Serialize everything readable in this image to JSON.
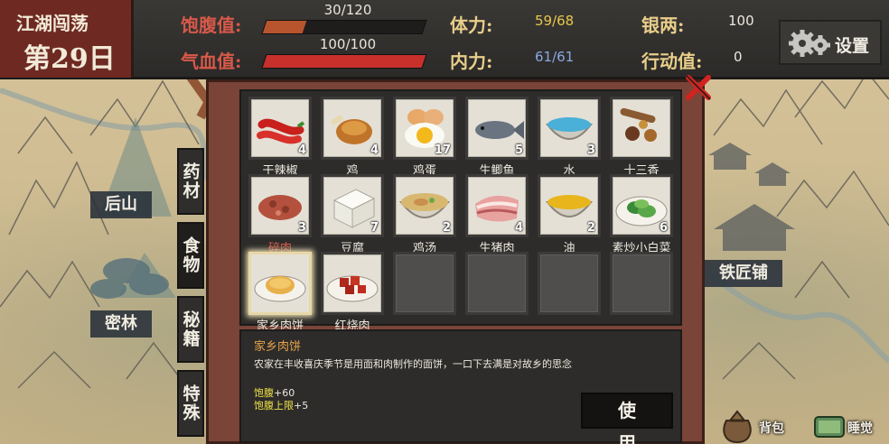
{
  "header": {
    "location": "江湖闯荡",
    "day": "第29日",
    "satiety": {
      "label": "饱腹值:",
      "text": "30/120",
      "fraction": 0.25,
      "color": "#b8542e"
    },
    "health": {
      "label": "气血值:",
      "text": "100/100",
      "fraction": 1.0,
      "color": "#c8302c"
    },
    "stamina": {
      "label": "体力:",
      "value": "59/68"
    },
    "inner_power": {
      "label": "内力:",
      "value": "61/61"
    },
    "silver": {
      "label": "银两:",
      "value": "100"
    },
    "action_points": {
      "label": "行动值:",
      "value": "0"
    },
    "settings_label": "设置"
  },
  "map": {
    "places": [
      "后山",
      "密林",
      "铁匠铺"
    ]
  },
  "inventory": {
    "tabs": [
      "药材",
      "食物",
      "秘籍",
      "特殊"
    ],
    "active_tab": "食物",
    "items": [
      {
        "name": "干辣椒",
        "count": "4",
        "icon": "dried-chili-icon"
      },
      {
        "name": "鸡",
        "count": "4",
        "icon": "roast-chicken-icon"
      },
      {
        "name": "鸡蛋",
        "count": "17",
        "icon": "egg-icon"
      },
      {
        "name": "生鲫鱼",
        "count": "5",
        "icon": "raw-fish-icon"
      },
      {
        "name": "水",
        "count": "3",
        "icon": "water-bowl-icon"
      },
      {
        "name": "十三香",
        "count": "",
        "icon": "spices-icon"
      },
      {
        "name": "碎肉",
        "count": "3",
        "icon": "minced-meat-icon",
        "red": true
      },
      {
        "name": "豆腐",
        "count": "7",
        "icon": "tofu-icon"
      },
      {
        "name": "鸡汤",
        "count": "2",
        "icon": "chicken-soup-icon"
      },
      {
        "name": "生猪肉",
        "count": "4",
        "icon": "raw-pork-icon"
      },
      {
        "name": "油",
        "count": "2",
        "icon": "oil-bowl-icon"
      },
      {
        "name": "素炒小白菜",
        "count": "6",
        "icon": "stir-fried-greens-icon"
      },
      {
        "name": "家乡肉饼",
        "count": "",
        "icon": "meat-pie-icon",
        "selected": true
      },
      {
        "name": "红烧肉",
        "count": "",
        "icon": "braised-pork-icon"
      }
    ],
    "empty_slots": 4,
    "detail": {
      "title": "家乡肉饼",
      "description": "农家在丰收喜庆季节是用面和肉制作的面饼，一口下去满是对故乡的思念",
      "effects": [
        {
          "key": "饱腹",
          "val": "+60"
        },
        {
          "key": "饱腹上限",
          "val": "+5"
        }
      ],
      "use_label": "使 用"
    }
  },
  "bottom": {
    "bag_label": "背包",
    "sleep_label": "睡觉"
  }
}
